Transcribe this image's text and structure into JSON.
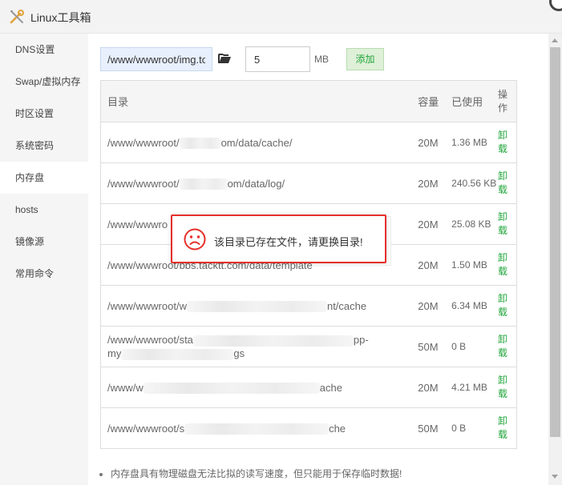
{
  "window": {
    "title": "Linux工具箱",
    "icon": "tools-icon"
  },
  "sidebar": {
    "items": [
      {
        "label": "DNS设置",
        "active": false
      },
      {
        "label": "Swap/虚拟内存",
        "active": false
      },
      {
        "label": "时区设置",
        "active": false
      },
      {
        "label": "系统密码",
        "active": false
      },
      {
        "label": "内存盘",
        "active": true
      },
      {
        "label": "hosts",
        "active": false
      },
      {
        "label": "镜像源",
        "active": false
      },
      {
        "label": "常用命令",
        "active": false
      }
    ]
  },
  "form": {
    "path_value": "/www/wwwroot/img.tc",
    "size_value": "5",
    "unit": "MB",
    "add_label": "添加",
    "folder_icon": "folder-open-icon"
  },
  "table": {
    "headers": {
      "dir": "目录",
      "capacity": "容量",
      "used": "已使用",
      "op": "操作"
    },
    "rows": [
      {
        "dir_prefix": "/www/wwwroot/",
        "dir_suffix": "om/data/cache/",
        "capacity": "20M",
        "used": "1.36 MB",
        "op": "卸载"
      },
      {
        "dir_prefix": "/www/wwwroot/",
        "dir_suffix": "om/data/log/",
        "capacity": "20M",
        "used": "240.56 KB",
        "op": "卸载"
      },
      {
        "dir_prefix": "/www/wwwro",
        "dir_suffix": "",
        "capacity": "20M",
        "used": "25.08 KB",
        "op": "卸载"
      },
      {
        "dir_prefix": "/www/wwwroot/bbs.tacktt.com/data/template",
        "dir_suffix": "",
        "capacity": "20M",
        "used": "1.50 MB",
        "op": "卸载"
      },
      {
        "dir_prefix": "/www/wwwroot/w",
        "dir_suffix": "nt/cache",
        "capacity": "20M",
        "used": "6.34 MB",
        "op": "卸载"
      },
      {
        "dir_prefix": "/www/wwwroot/sta",
        "dir_suffix": "pp-",
        "dir_line2_prefix": "my",
        "dir_line2_suffix": "gs",
        "capacity": "50M",
        "used": "0 B",
        "op": "卸载"
      },
      {
        "dir_prefix": "/www/w",
        "dir_suffix": "ache",
        "capacity": "20M",
        "used": "4.21 MB",
        "op": "卸载"
      },
      {
        "dir_prefix": "/www/wwwroot/s",
        "dir_suffix": "che",
        "capacity": "50M",
        "used": "0 B",
        "op": "卸载"
      }
    ]
  },
  "note": "内存盘具有物理磁盘无法比拟的读写速度，但只能用于保存临时数据!",
  "toast": {
    "message": "该目录已存在文件，请更换目录!",
    "icon": "sad-face-icon"
  },
  "colors": {
    "accent_green": "#20a53a",
    "error_red": "#e5302a",
    "sidebar_bg": "#f5f5f5"
  }
}
